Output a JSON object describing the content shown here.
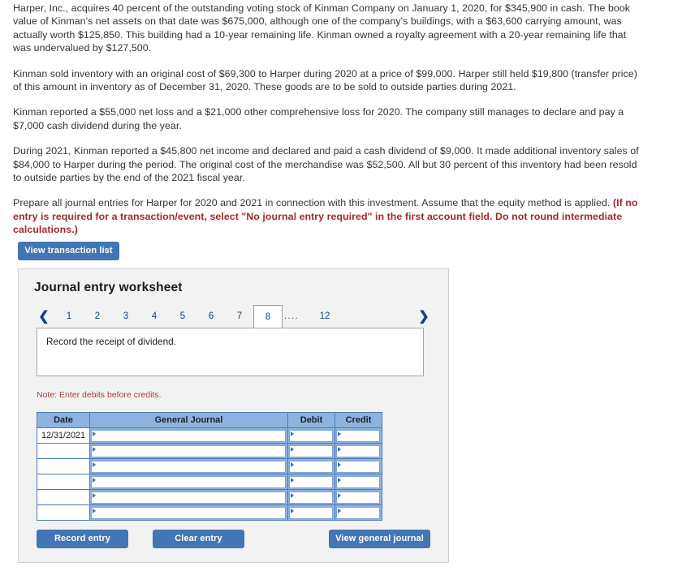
{
  "problem": {
    "paragraphs": [
      "Harper, Inc., acquires 40 percent of the outstanding voting stock of Kinman Company on January 1, 2020, for $345,900 in cash. The book value of Kinman's net assets on that date was $675,000, although one of the company's buildings, with a $63,600 carrying amount, was actually worth $125,850. This building had a 10-year remaining life. Kinman owned a royalty agreement with a 20-year remaining life that was undervalued by $127,500.",
      "Kinman sold inventory with an original cost of $69,300 to Harper during 2020 at a price of $99,000. Harper still held $19,800 (transfer price) of this amount in inventory as of December 31, 2020. These goods are to be sold to outside parties during 2021.",
      "Kinman reported a $55,000 net loss and a $21,000 other comprehensive loss for 2020. The company still manages to declare and pay a $7,000 cash dividend during the year.",
      "During 2021, Kinman reported a $45,800 net income and declared and paid a cash dividend of $9,000. It made additional inventory sales of $84,000 to Harper during the period. The original cost of the merchandise was $52,500. All but 30 percent of this inventory had been resold to outside parties by the end of the 2021 fiscal year."
    ],
    "instruction_plain": "Prepare all journal entries for Harper for 2020 and 2021 in connection with this investment. Assume that the equity method is applied.",
    "instruction_emphasis": "(If no entry is required for a transaction/event, select \"No journal entry required\" in the first account field. Do not round intermediate calculations.)"
  },
  "buttons": {
    "view_transaction_list": "View transaction list",
    "record_entry": "Record entry",
    "clear_entry": "Clear entry",
    "view_general_journal": "View general journal"
  },
  "worksheet": {
    "title": "Journal entry worksheet",
    "pager": {
      "prev_icon": "chevron-left-icon",
      "next_icon": "chevron-right-icon",
      "pages": [
        "1",
        "2",
        "3",
        "4",
        "5",
        "6",
        "7",
        "8"
      ],
      "ellipsis": "....",
      "last_page": "12",
      "active_page": "8"
    },
    "description": "Record the receipt of dividend.",
    "note": "Note: Enter debits before credits.",
    "table": {
      "headers": [
        "Date",
        "General Journal",
        "Debit",
        "Credit"
      ],
      "rows": [
        {
          "date": "12/31/2021",
          "general_journal": "",
          "debit": "",
          "credit": ""
        },
        {
          "date": "",
          "general_journal": "",
          "debit": "",
          "credit": ""
        },
        {
          "date": "",
          "general_journal": "",
          "debit": "",
          "credit": ""
        },
        {
          "date": "",
          "general_journal": "",
          "debit": "",
          "credit": ""
        },
        {
          "date": "",
          "general_journal": "",
          "debit": "",
          "credit": ""
        },
        {
          "date": "",
          "general_journal": "",
          "debit": "",
          "credit": ""
        }
      ]
    }
  },
  "colors": {
    "accent_button": "#4276b4",
    "table_header": "#8fb3df",
    "emphasis_red": "#a02b2b",
    "note_red": "#9c4444",
    "panel_bg": "#f2f2f2"
  }
}
